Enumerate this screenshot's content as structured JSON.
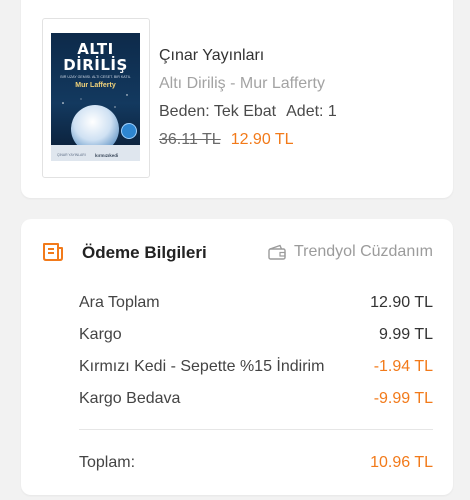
{
  "product": {
    "brand": "Çınar Yayınları",
    "name": "Altı Diriliş - Mur Lafferty",
    "variant_label": "Beden: Tek Ebat",
    "quantity_label": "Adet: 1",
    "old_price": "36.11 TL",
    "new_price": "12.90 TL",
    "cover": {
      "title_line1": "ALTI",
      "title_line2": "DİRİLİŞ",
      "subtitle": "BİR UZAY GEMİSİ. ALTI CESET. BİR KATİL",
      "author": "Mur Lafferty",
      "publisher": "ÇINAR YAYINLARI",
      "logo": "kırmızıkedi"
    }
  },
  "payment": {
    "title": "Ödeme Bilgileri",
    "wallet_label": "Trendyol Cüzdanım",
    "rows": [
      {
        "label": "Ara Toplam",
        "value": "12.90 TL"
      },
      {
        "label": "Kargo",
        "value": "9.99 TL"
      },
      {
        "label": "Kırmızı Kedi - Sepette %15 İndirim",
        "value": "-1.94 TL"
      },
      {
        "label": "Kargo Bedava",
        "value": "-9.99 TL"
      }
    ],
    "total_label": "Toplam:",
    "total_value": "10.96 TL"
  },
  "colors": {
    "accent": "#f27a1a",
    "muted": "#a3a3a3",
    "background": "#f2f2f2"
  },
  "icons": {
    "payment_header": "receipt-icon",
    "wallet": "wallet-icon"
  }
}
